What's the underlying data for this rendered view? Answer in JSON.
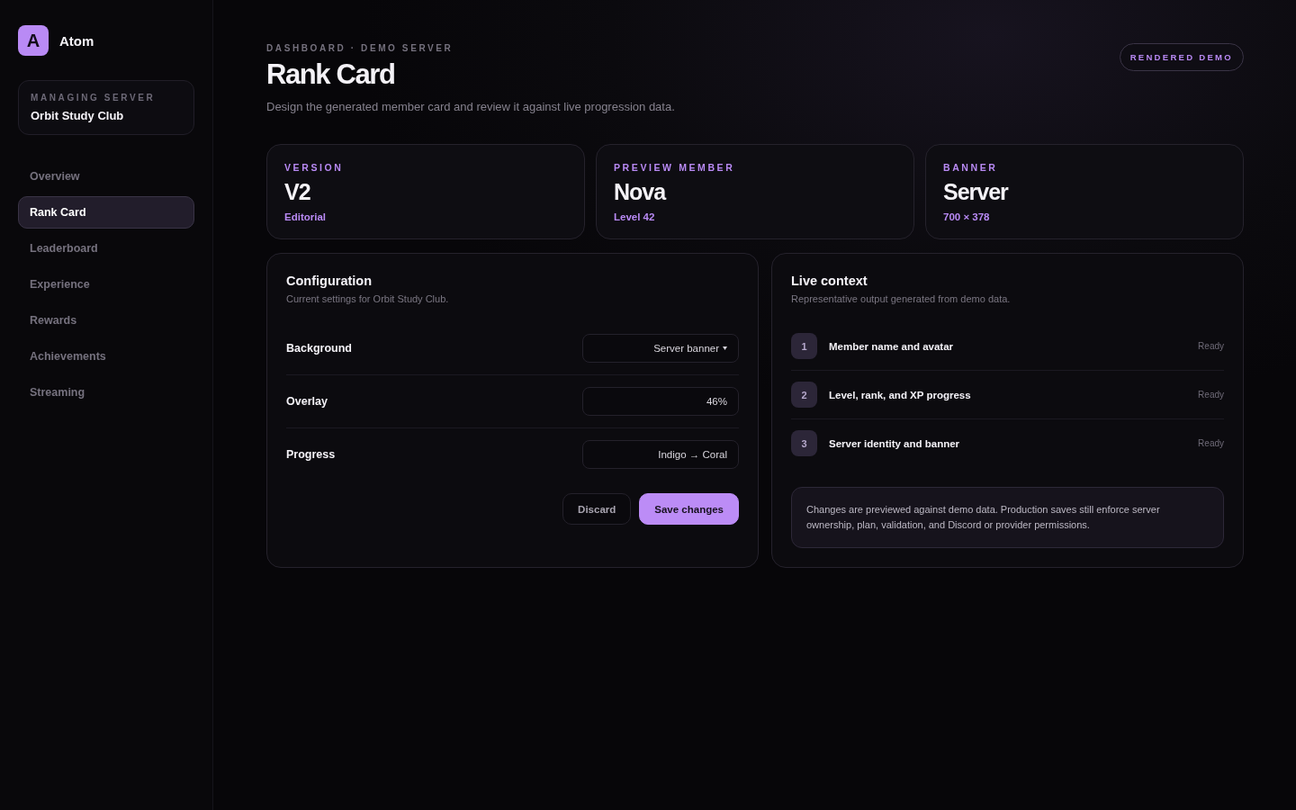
{
  "brand": {
    "logo": "A",
    "name": "Atom"
  },
  "server": {
    "label": "MANAGING SERVER",
    "name": "Orbit Study Club"
  },
  "nav": [
    {
      "label": "Overview",
      "selected": false
    },
    {
      "label": "Rank Card",
      "selected": true
    },
    {
      "label": "Leaderboard",
      "selected": false
    },
    {
      "label": "Experience",
      "selected": false
    },
    {
      "label": "Rewards",
      "selected": false
    },
    {
      "label": "Achievements",
      "selected": false
    },
    {
      "label": "Streaming",
      "selected": false
    }
  ],
  "header": {
    "breadcrumb": "DASHBOARD · DEMO SERVER",
    "title": "Rank Card",
    "subtitle": "Design the generated member card and review it against live progression data.",
    "badge": "RENDERED DEMO"
  },
  "stats": [
    {
      "label": "VERSION",
      "value": "V2",
      "detail": "Editorial"
    },
    {
      "label": "PREVIEW MEMBER",
      "value": "Nova",
      "detail": "Level 42"
    },
    {
      "label": "BANNER",
      "value": "Server",
      "detail": "700 × 378"
    }
  ],
  "configuration": {
    "title": "Configuration",
    "subtitle": "Current settings for Orbit Study Club.",
    "settings": [
      {
        "label": "Background",
        "value": "Server banner",
        "kind": "select"
      },
      {
        "label": "Overlay",
        "value": "46%",
        "kind": "text"
      },
      {
        "label": "Progress",
        "value": "Indigo → Coral",
        "kind": "text"
      }
    ],
    "buttons": [
      {
        "label": "Discard",
        "kind": "secondary"
      },
      {
        "label": "Save changes",
        "kind": "primary"
      }
    ]
  },
  "live_context": {
    "title": "Live context",
    "subtitle": "Representative output generated from demo data.",
    "items": [
      {
        "number": "1",
        "label": "Member name and avatar",
        "status": "Ready"
      },
      {
        "number": "2",
        "label": "Level, rank, and XP progress",
        "status": "Ready"
      },
      {
        "number": "3",
        "label": "Server identity and banner",
        "status": "Ready"
      }
    ],
    "note": "Changes are previewed against demo data. Production saves still enforce server ownership, plan, validation, and Discord or provider permissions."
  }
}
